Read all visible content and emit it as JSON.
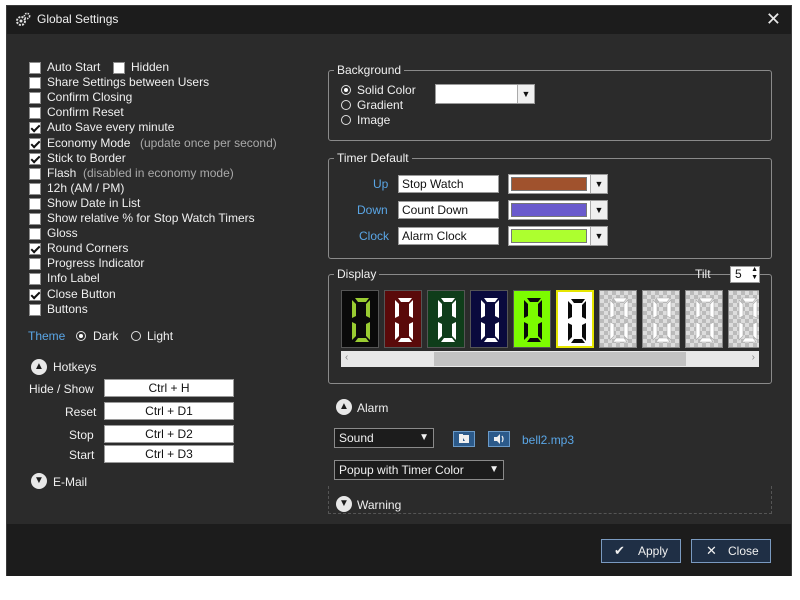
{
  "window": {
    "title": "Global Settings",
    "close_glyph": "✕"
  },
  "options": [
    {
      "label": "Auto Start",
      "checked": false
    },
    {
      "label": "Share Settings between Users",
      "checked": false
    },
    {
      "label": "Confirm Closing",
      "checked": false
    },
    {
      "label": "Confirm Reset",
      "checked": false
    },
    {
      "label": "Auto Save every minute",
      "checked": true
    },
    {
      "label": "Economy Mode",
      "checked": true,
      "note": "(update once per second)"
    },
    {
      "label": "Stick to Border",
      "checked": true
    },
    {
      "label": "Flash",
      "checked": false,
      "note": "(disabled in economy mode)"
    },
    {
      "label": "12h (AM / PM)",
      "checked": false
    },
    {
      "label": "Show Date in List",
      "checked": false
    },
    {
      "label": "Show relative % for Stop Watch Timers",
      "checked": false
    },
    {
      "label": "Gloss",
      "checked": false
    },
    {
      "label": "Round Corners",
      "checked": true
    },
    {
      "label": "Progress Indicator",
      "checked": false
    },
    {
      "label": "Info Label",
      "checked": false
    },
    {
      "label": "Close Button",
      "checked": true
    },
    {
      "label": "Buttons",
      "checked": false
    }
  ],
  "hidden": {
    "label": "Hidden",
    "checked": false
  },
  "theme": {
    "label": "Theme",
    "options": [
      "Dark",
      "Light"
    ],
    "selected": "Dark"
  },
  "hotkeys": {
    "title": "Hotkeys",
    "items": [
      {
        "label": "Hide / Show",
        "value": "Ctrl + H"
      },
      {
        "label": "Reset",
        "value": "Ctrl + D1"
      },
      {
        "label": "Stop",
        "value": "Ctrl + D2"
      },
      {
        "label": "Start",
        "value": "Ctrl + D3"
      }
    ]
  },
  "email": {
    "title": "E-Mail"
  },
  "background": {
    "title": "Background",
    "options": [
      "Solid Color",
      "Gradient",
      "Image"
    ],
    "selected": "Solid Color",
    "color": "#ffffff"
  },
  "timer_default": {
    "title": "Timer Default",
    "rows": [
      {
        "label": "Up",
        "name": "Stop Watch",
        "color": "#a0522d"
      },
      {
        "label": "Down",
        "name": "Count Down",
        "color": "#6a5acd"
      },
      {
        "label": "Clock",
        "name": "Alarm Clock",
        "color": "#adff2f"
      }
    ]
  },
  "display": {
    "title": "Display",
    "tilt_label": "Tilt",
    "tilt_value": "5",
    "digits": [
      {
        "value": "0",
        "bg": "#0a0a0a",
        "fg": "#9acd32",
        "border": "#555555",
        "checker": false
      },
      {
        "value": "0",
        "bg": "#5a0a0a",
        "fg": "#ffffff",
        "border": "#555555",
        "checker": false
      },
      {
        "value": "0",
        "bg": "#0f3d1a",
        "fg": "#ffffff",
        "border": "#555555",
        "checker": false
      },
      {
        "value": "0",
        "bg": "#0a0a3d",
        "fg": "#ffffff",
        "border": "#555555",
        "checker": false
      },
      {
        "value": "0",
        "bg": "#7cfc00",
        "fg": "#0a0a0a",
        "border": "#555555",
        "checker": false
      },
      {
        "value": "0",
        "bg": "#ffffff",
        "fg": "#0a0a0a",
        "border": "#e6e600",
        "checker": false
      },
      {
        "value": "0",
        "bg": "#dddddd",
        "fg": "#ffffff",
        "border": "#888888",
        "checker": true
      },
      {
        "value": "0",
        "bg": "#dddddd",
        "fg": "#ffffff",
        "border": "#888888",
        "checker": true
      },
      {
        "value": "0",
        "bg": "#dddddd",
        "fg": "#ffffff",
        "border": "#888888",
        "checker": true
      },
      {
        "value": "0",
        "bg": "#dddddd",
        "fg": "#ffffff",
        "border": "#888888",
        "checker": true
      }
    ]
  },
  "alarm": {
    "title": "Alarm",
    "sound_select": "Sound",
    "file": "bell2.mp3",
    "popup_select": "Popup with Timer Color"
  },
  "warning": {
    "title": "Warning"
  },
  "buttons": {
    "apply": "Apply",
    "close": "Close"
  },
  "colors": {
    "accent_blue": "#5aa6e6",
    "window_bg": "#2b2b2b",
    "title_bg": "#1c1c1c"
  }
}
